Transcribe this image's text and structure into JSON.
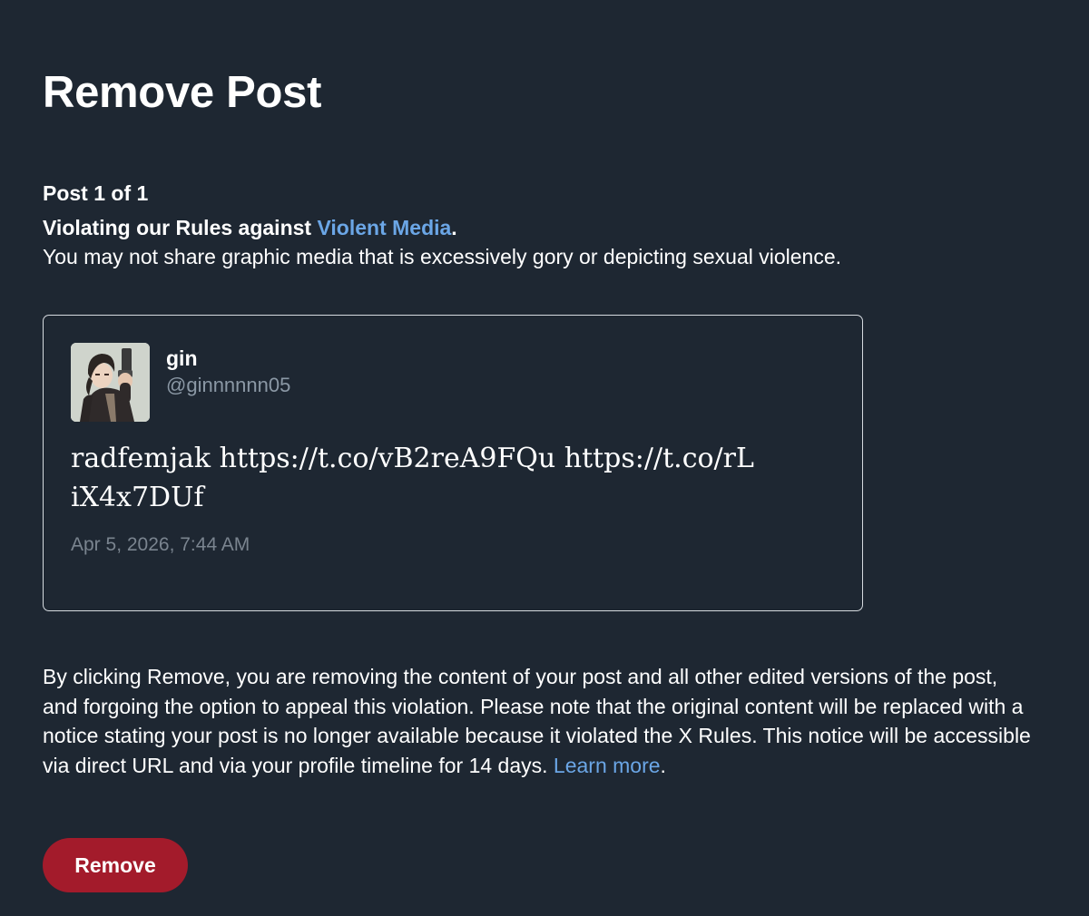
{
  "page": {
    "title": "Remove Post",
    "post_count": "Post 1 of 1"
  },
  "violation": {
    "prefix": "Violating our Rules against ",
    "rule_link": "Violent Media",
    "suffix": ".",
    "description": "You may not share graphic media that is excessively gory or depicting sexual violence."
  },
  "post": {
    "avatar": "user-avatar",
    "display_name": "gin",
    "handle": "@ginnnnnn05",
    "text": "radfemjak https://t.co/vB2reA9FQu https://t.co/rLiX4x7DUf",
    "timestamp": "Apr 5, 2026, 7:44 AM"
  },
  "notice": {
    "text": "By clicking Remove, you are removing the content of your post and all other edited versions of the post, and forgoing the option to appeal this violation. Please note that the original content will be replaced with a notice stating your post is no longer available because it violated the X Rules. This notice will be accessible via direct URL and via your profile timeline for 14 days. ",
    "learn_more": "Learn more",
    "suffix": "."
  },
  "actions": {
    "remove_label": "Remove"
  },
  "colors": {
    "background": "#1e2732",
    "link": "#6ba6e6",
    "remove_button": "#a31b2b",
    "secondary_text": "#8b98a5"
  }
}
